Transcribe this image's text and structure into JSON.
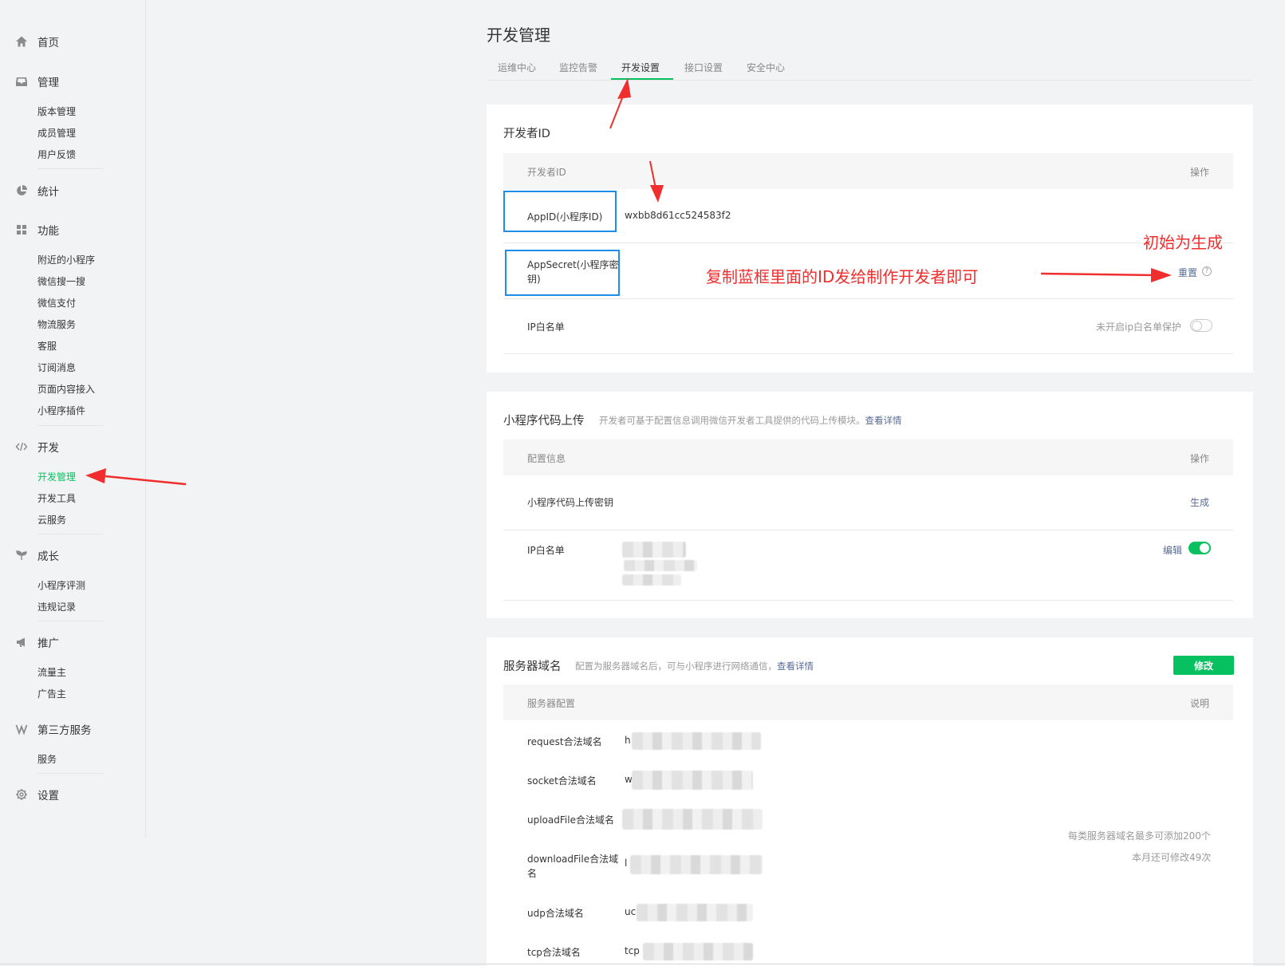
{
  "sidebar": {
    "groups": [
      {
        "icon": "home-icon",
        "label": "首页",
        "items": []
      },
      {
        "icon": "inbox-icon",
        "label": "管理",
        "items": [
          "版本管理",
          "成员管理",
          "用户反馈"
        ]
      },
      {
        "icon": "pie-chart-icon",
        "label": "统计",
        "items": []
      },
      {
        "icon": "grid-icon",
        "label": "功能",
        "items": [
          "附近的小程序",
          "微信搜一搜",
          "微信支付",
          "物流服务",
          "客服",
          "订阅消息",
          "页面内容接入",
          "小程序插件"
        ]
      },
      {
        "icon": "code-icon",
        "label": "开发",
        "items": [
          "开发管理",
          "开发工具",
          "云服务"
        ]
      },
      {
        "icon": "sprout-icon",
        "label": "成长",
        "items": [
          "小程序评测",
          "违规记录"
        ]
      },
      {
        "icon": "megaphone-icon",
        "label": "推广",
        "items": [
          "流量主",
          "广告主"
        ]
      },
      {
        "icon": "third-party-icon",
        "label": "第三方服务",
        "items": [
          "服务"
        ]
      },
      {
        "icon": "gear-icon",
        "label": "设置",
        "items": []
      }
    ],
    "active_item": "开发管理"
  },
  "header": {
    "title": "开发管理",
    "tabs": [
      "运维中心",
      "监控告警",
      "开发设置",
      "接口设置",
      "安全中心"
    ],
    "active_tab": "开发设置"
  },
  "dev_id": {
    "title": "开发者ID",
    "col_left": "开发者ID",
    "col_right": "操作",
    "appid_label": "AppID(小程序ID)",
    "appid_value": "wxbb8d61cc524583f2",
    "secret_label_1": "AppSecret(小程序密",
    "secret_label_2": "钥)",
    "reset_link": "重置",
    "ip_label": "IP白名单",
    "ip_status": "未开启ip白名单保护"
  },
  "upload": {
    "title": "小程序代码上传",
    "desc": "开发者可基于配置信息调用微信开发者工具提供的代码上传模块。",
    "desc_link": "查看详情",
    "col_left": "配置信息",
    "col_right": "操作",
    "key_label": "小程序代码上传密钥",
    "generate_link": "生成",
    "ip_label": "IP白名单",
    "edit_link": "编辑"
  },
  "server": {
    "title": "服务器域名",
    "desc": "配置为服务器域名后，可与小程序进行网络通信，",
    "desc_link": "查看详情",
    "modify_button": "修改",
    "col_left": "服务器配置",
    "col_right": "说明",
    "rows": [
      {
        "label": "request合法域名",
        "prefix": "h"
      },
      {
        "label": "socket合法域名",
        "prefix": "w"
      },
      {
        "label": "uploadFile合法域名",
        "prefix": ""
      },
      {
        "label_1": "downloadFile合法域",
        "label_2": "名",
        "prefix": "l"
      },
      {
        "label": "udp合法域名",
        "prefix": "uc"
      },
      {
        "label": "tcp合法域名",
        "prefix": "tcp"
      }
    ],
    "note_1": "每类服务器域名最多可添加200个",
    "note_2": "本月还可修改49次"
  },
  "annotations": {
    "copy_hint": "复制蓝框里面的ID发给制作开发者即可",
    "initial_hint": "初始为生成"
  },
  "colors": {
    "accent_green": "#07c160",
    "link_blue": "#576b95",
    "annotation_red": "#f02e2e",
    "annotation_blue": "#1f8ee8"
  }
}
